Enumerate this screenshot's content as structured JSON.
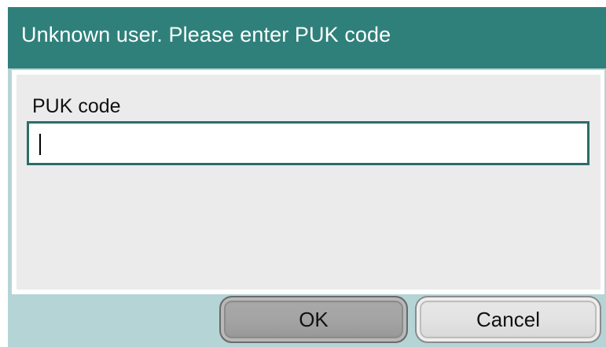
{
  "dialog": {
    "title": "Unknown user. Please enter PUK code"
  },
  "form": {
    "puk_label": "PUK code",
    "puk_value": ""
  },
  "buttons": {
    "ok_label": "OK",
    "cancel_label": "Cancel"
  }
}
